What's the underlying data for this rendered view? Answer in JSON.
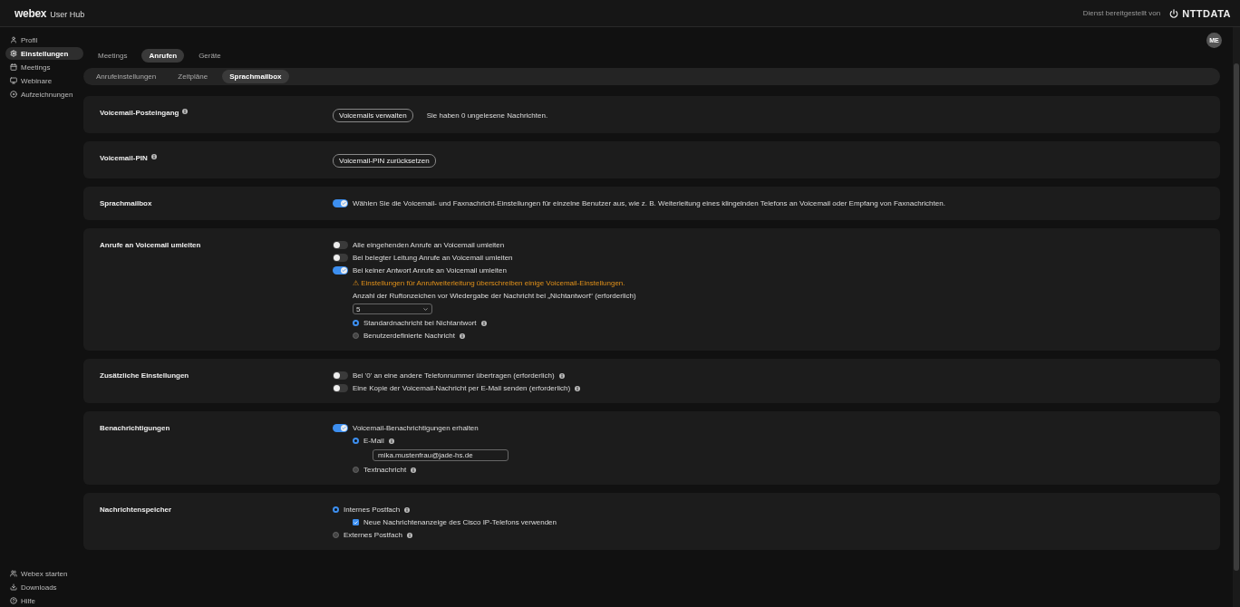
{
  "header": {
    "logo": "webex",
    "product": "User Hub",
    "provided_by": "Dienst bereitgestellt von",
    "brand": "NTTDATA"
  },
  "sidebar": {
    "items": [
      {
        "label": "Profil",
        "selected": false
      },
      {
        "label": "Einstellungen",
        "selected": true
      },
      {
        "label": "Meetings",
        "selected": false
      },
      {
        "label": "Webinare",
        "selected": false
      },
      {
        "label": "Aufzeichnungen",
        "selected": false
      }
    ],
    "bottom_items": [
      {
        "label": "Webex starten",
        "selected": false
      },
      {
        "label": "Downloads",
        "selected": false
      },
      {
        "label": "Hilfe",
        "selected": false
      }
    ]
  },
  "avatar": "ME",
  "tabs": [
    {
      "label": "Meetings",
      "selected": false
    },
    {
      "label": "Anrufen",
      "selected": true
    },
    {
      "label": "Geräte",
      "selected": false
    }
  ],
  "subtabs": [
    {
      "label": "Anrufeinstellungen",
      "selected": false
    },
    {
      "label": "Zeitpläne",
      "selected": false
    },
    {
      "label": "Sprachmailbox",
      "selected": true
    }
  ],
  "sections": [
    {
      "label": "Voicemail-Posteingang",
      "info": true,
      "rows": [
        {
          "kind": "button",
          "label": "Voicemails verwalten",
          "note": "Sie haben 0 ungelesene Nachrichten."
        }
      ]
    },
    {
      "label": "Voicemail-PIN",
      "info": true,
      "rows": [
        {
          "kind": "button",
          "label": "Voicemail-PIN zurücksetzen"
        }
      ]
    },
    {
      "label": "Sprachmailbox",
      "info": false,
      "rows": [
        {
          "kind": "toggle",
          "on": true,
          "label": "Wählen Sie die Voicemail- und Faxnachricht-Einstellungen für einzelne Benutzer aus, wie z. B. Weiterleitung eines klingelnden Telefons an Voicemail oder Empfang von Faxnachrichten."
        }
      ]
    },
    {
      "label": "Anrufe an Voicemail umleiten",
      "info": false,
      "rows": [
        {
          "kind": "toggle",
          "on": false,
          "label": "Alle eingehenden Anrufe an Voicemail umleiten"
        },
        {
          "kind": "toggle",
          "on": false,
          "label": "Bei belegter Leitung Anrufe an Voicemail umleiten"
        },
        {
          "kind": "toggle",
          "on": true,
          "label": "Bei keiner Antwort Anrufe an Voicemail umleiten",
          "children": [
            {
              "kind": "warning",
              "label": "⚠ Einstellungen für Anrufweiterleitung überschreiben einige Voicemail-Einstellungen."
            },
            {
              "kind": "select",
              "label": "Anzahl der Ruftonzeichen vor Wiedergabe der Nachricht bei „Nichtantwort“ (erforderlich)",
              "value": "5"
            },
            {
              "kind": "radio",
              "selected": true,
              "label": "Standardnachricht bei Nichtantwort",
              "info": true
            },
            {
              "kind": "radio",
              "selected": false,
              "label": "Benutzerdefinierte Nachricht",
              "info": true
            }
          ]
        }
      ]
    },
    {
      "label": "Zusätzliche Einstellungen",
      "info": false,
      "rows": [
        {
          "kind": "toggle",
          "on": false,
          "label": "Bei '0' an eine andere Telefonnummer übertragen (erforderlich)",
          "info": true
        },
        {
          "kind": "toggle",
          "on": false,
          "label": "Eine Kopie der Voicemail-Nachricht per E-Mail senden (erforderlich)",
          "info": true
        }
      ]
    },
    {
      "label": "Benachrichtigungen",
      "info": false,
      "rows": [
        {
          "kind": "toggle",
          "on": true,
          "label": "Voicemail-Benachrichtigungen erhalten",
          "children": [
            {
              "kind": "radio",
              "selected": true,
              "label": "E-Mail",
              "info": true,
              "children": [
                {
                  "kind": "input",
                  "value": "mika.mustenfrau@jade-hs.de"
                }
              ]
            },
            {
              "kind": "radio",
              "selected": false,
              "label": "Textnachricht",
              "info": true
            }
          ]
        }
      ]
    },
    {
      "label": "Nachrichtenspeicher",
      "info": false,
      "rows": [
        {
          "kind": "radio",
          "selected": true,
          "label": "Internes Postfach",
          "info": true,
          "children": [
            {
              "kind": "checkbox",
              "checked": true,
              "label": "Neue Nachrichtenanzeige des Cisco IP-Telefons verwenden"
            }
          ]
        },
        {
          "kind": "radio",
          "selected": false,
          "label": "Externes Postfach",
          "info": true
        }
      ]
    }
  ]
}
